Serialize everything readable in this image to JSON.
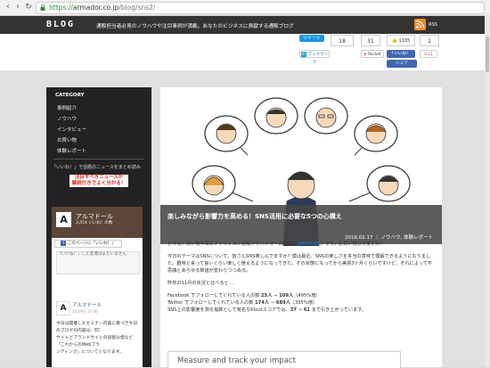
{
  "browser": {
    "url_scheme": "https://",
    "url_host": "armador.co.jp",
    "url_path": "/blog/sns2/"
  },
  "site": {
    "logo": "BLOG",
    "tagline": "通販担当者必見のノウハウや注目事例が満載。あなたのビジネスに貢献する通販ブログ",
    "rss_label": "RSS"
  },
  "share": {
    "tweet_label": "ツイート",
    "tweet_count": "18",
    "hatena_count": "31",
    "like_count": "1105",
    "gplus_count": "1",
    "hatena_label": "ブックマーク",
    "pocket_label": "Pocket",
    "fb_like_label": "いいね！",
    "gplus_label": "G+1",
    "fb_share_label": "シェア"
  },
  "sidebar": {
    "category_title": "CATEGORY",
    "categories": [
      {
        "label": "事例紹介"
      },
      {
        "label": "ノウハウ"
      },
      {
        "label": "インタビュー"
      },
      {
        "label": "お買い物"
      },
      {
        "label": "体験レポート"
      }
    ],
    "fb_invite": "「いいね！」で話題のニュースをまとめ読み",
    "promo_line1": "注目すべきニュースが",
    "promo_line2": "解説付きでよく分かる！",
    "fb_page_name": "アルマドール",
    "fb_page_count": "3,454 いいね！の数",
    "fb_page_like": "このページに「いいね！」",
    "fb_feed_notice": "「いいね！」した友達はまだいません",
    "post_author": "アルマドール",
    "post_date": "2月29日 17:30",
    "post_lines": [
      "今日は開催したセミナー内容に基づき今日のブログの内容は、EC",
      "サイトとブランドサイトの役割分担など「これからのWebブラ",
      "ンディング」についてとなります。"
    ]
  },
  "article": {
    "title": "楽しみながら影響力を高める！SNS活用に必要な5つの心構え",
    "date": "2016.02.17",
    "categories": "ノウハウ, 体験レポート",
    "p1_before_link": "どうも！買い物中毒のファッション通販アドバイザーの野田（",
    "p1_link": "@KURUZE",
    "p1_after_link": "）です。お買い物してますか？",
    "p2": "今日のテーマはSNSについて。皆さんSNS楽しんでますか？僕は最近、SNSの楽しさを本当の意味で理解できるようになりました。趣味と言って良いくらい楽しく使えるようになってきた。その状態になってから実質3ヶ月くらいですけど、それによって不思議とあらゆる数値が変わりつつある。",
    "p3": "昨年の11月の状況と比べると．．．",
    "stats": [
      {
        "label": "Facebook でフォローしてくれている人の数 ",
        "from": "25人",
        "to": "109人",
        "pct": "（495%増）"
      },
      {
        "label": "Twitter でフォローしてくれている人の数 ",
        "from": "174人",
        "to": "689人",
        "pct": "（395%増）"
      },
      {
        "label": "SNS上の影響度を測る指数として有名なKloutスコアでは、",
        "from": "37",
        "to": "61",
        "pct": "まで引き上がっています。"
      }
    ],
    "arrow": "→"
  },
  "ad": {
    "text": "Measure and track your impact"
  }
}
